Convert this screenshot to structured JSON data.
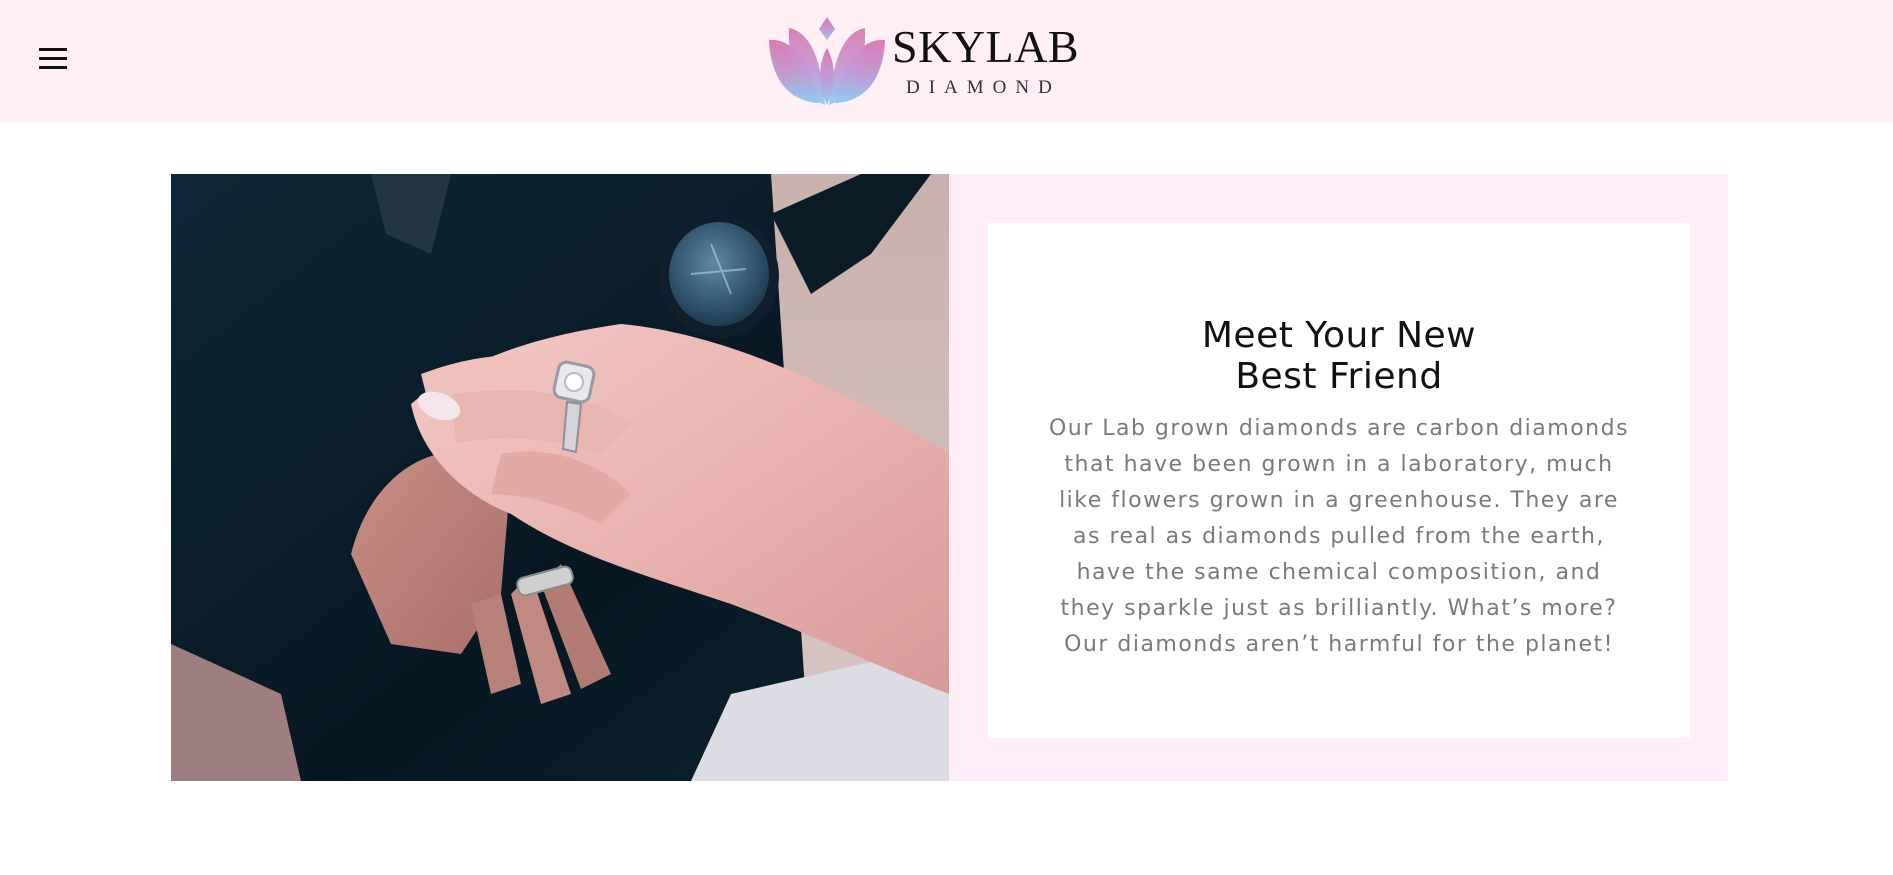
{
  "header": {
    "menu_icon": "hamburger-menu-icon",
    "logo": {
      "wordmark": "SKYLAB",
      "subtitle": "DIAMOND",
      "mark_icon": "lotus-icon",
      "gradient_top": "#d97db4",
      "gradient_bottom": "#8ccdf3"
    },
    "background": "#fff0f5"
  },
  "feature": {
    "image_description": "photo-hands-engagement-ring",
    "heading_line1": "Meet Your New",
    "heading_line2": "Best Friend",
    "body": "Our Lab grown diamonds are carbon diamonds that have been grown in a laboratory, much like flowers grown in a greenhouse. They are as real as diamonds pulled from the earth, have the same chemical composition, and they sparkle just as brilliantly. What’s more? Our diamonds aren’t harmful for the planet!",
    "panel_color": "#ffedf7"
  }
}
